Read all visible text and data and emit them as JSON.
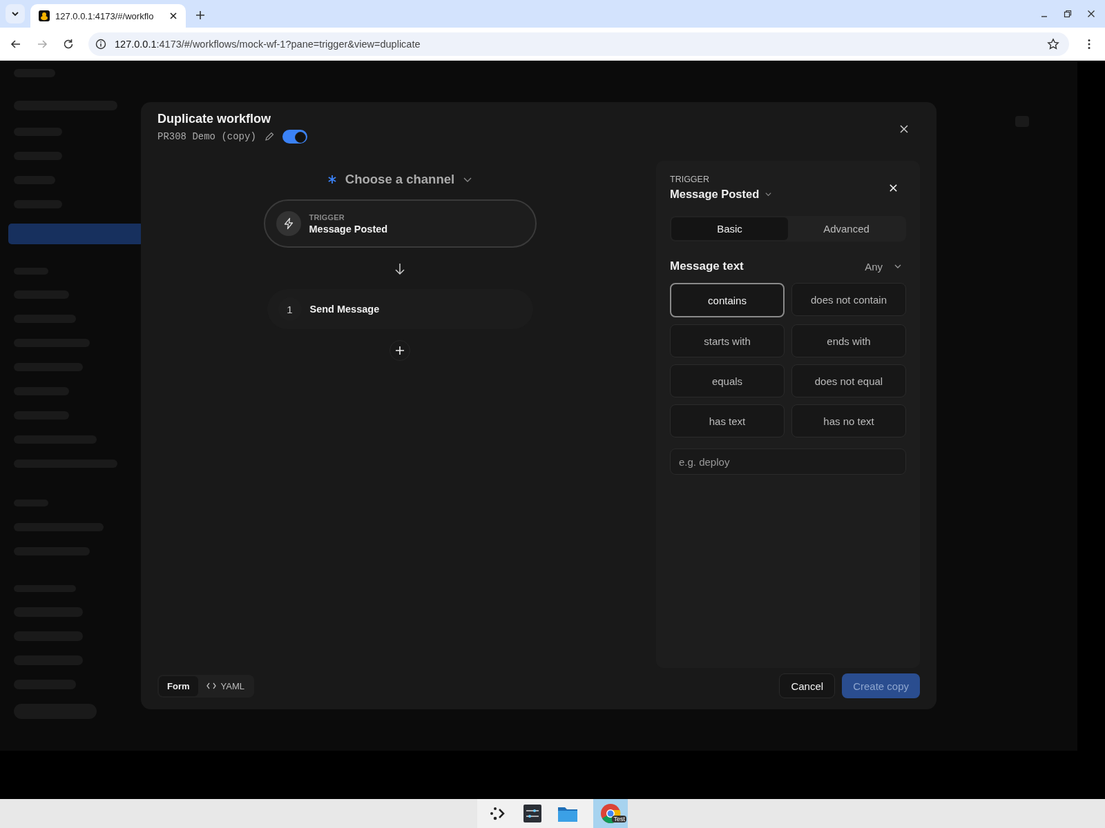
{
  "browser": {
    "tab_title": "127.0.0.1:4173/#/workflo",
    "url_host": "127.0.0.1",
    "url_rest": ":4173/#/workflows/mock-wf-1?pane=trigger&view=duplicate"
  },
  "modal": {
    "title": "Duplicate workflow",
    "name": "PR308 Demo (copy)",
    "enabled": true,
    "channel": "Choose a channel",
    "trigger": {
      "label": "TRIGGER",
      "name": "Message Posted"
    },
    "steps": [
      {
        "number": "1",
        "name": "Send Message"
      }
    ],
    "panel": {
      "label": "TRIGGER",
      "name": "Message Posted",
      "tabs": [
        {
          "label": "Basic",
          "selected": true
        },
        {
          "label": "Advanced",
          "selected": false
        }
      ],
      "field_label": "Message text",
      "match": "Any",
      "operators": [
        {
          "label": "contains",
          "selected": true
        },
        {
          "label": "does not contain",
          "selected": false
        },
        {
          "label": "starts with",
          "selected": false
        },
        {
          "label": "ends with",
          "selected": false
        },
        {
          "label": "equals",
          "selected": false
        },
        {
          "label": "does not equal",
          "selected": false
        },
        {
          "label": "has text",
          "selected": false
        },
        {
          "label": "has no text",
          "selected": false
        }
      ],
      "placeholder": "e.g. deploy"
    },
    "view_modes": [
      {
        "label": "Form",
        "selected": true
      },
      {
        "label": "YAML",
        "selected": false
      }
    ],
    "cancel": "Cancel",
    "create": {
      "label": "Create copy",
      "disabled": true
    }
  },
  "taskbar": {
    "badge": "Test"
  }
}
